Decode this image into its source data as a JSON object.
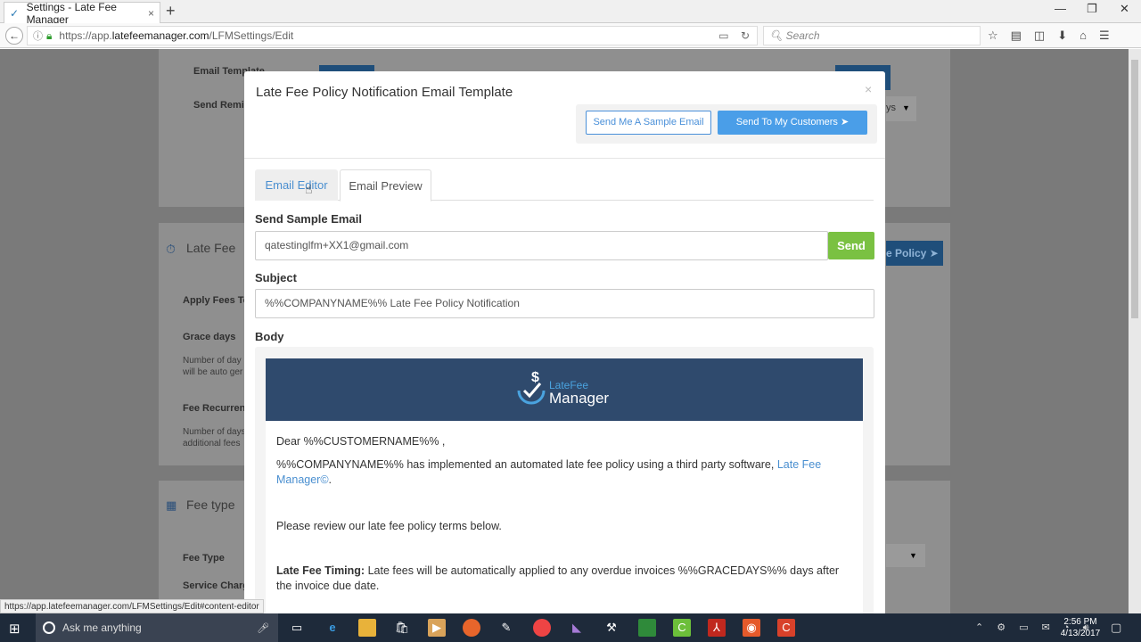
{
  "browser": {
    "tab_title": "Settings - Late Fee Manager",
    "tab_close": "×",
    "new_tab": "+",
    "url_prefix": "https://app.",
    "url_domain": "latefeemanager.com",
    "url_path": "/LFMSettings/Edit",
    "search_placeholder": "Search",
    "status_url": "https://app.latefeemanager.com/LFMSettings/Edit#content-editor"
  },
  "background": {
    "email_template_label": "Email Template",
    "send_reminder_label": "Send Remi",
    "late_fee_heading": "Late Fee",
    "apply_fees_label": "Apply Fees To",
    "grace_days_label": "Grace days",
    "grace_days_help": "Number of day",
    "grace_days_help2": "will be auto ger",
    "fee_recurrence_label": "Fee Recurren",
    "fee_recurrence_help": "Number of days",
    "fee_recurrence_help2": "additional fees",
    "fee_type_heading": "Fee type",
    "fee_type_label": "Fee Type",
    "service_charge_label": "Service Charg",
    "days_select": "ys",
    "policy_btn": "e Policy"
  },
  "modal": {
    "title": "Late Fee Policy Notification Email Template",
    "close": "×",
    "send_sample_btn": "Send Me A Sample Email",
    "send_customers_btn": "Send To My Customers",
    "tab_editor": "Email Editor",
    "tab_preview": "Email Preview",
    "send_sample_label": "Send Sample Email",
    "sample_email_value": "qatestinglfm+XX1@gmail.com",
    "send_btn": "Send",
    "subject_label": "Subject",
    "subject_value": "%%COMPANYNAME%% Late Fee Policy Notification",
    "body_label": "Body",
    "logo_line1": "LateFee",
    "logo_line2": "Manager",
    "greeting": "Dear %%CUSTOMERNAME%% ,",
    "para1_text": "%%COMPANYNAME%% has implemented an automated late fee policy using a third party software, ",
    "para1_link": "Late Fee Manager©",
    "para1_end": ".",
    "para2": "Please review our late fee policy terms below.",
    "timing_label": "Late Fee Timing:",
    "timing_text": " Late fees will be automatically applied to any overdue invoices %%GRACEDAYS%% days after the invoice due date."
  },
  "taskbar": {
    "cortana_text": "Ask me anything",
    "time": "2:56 PM",
    "date": "4/13/2017"
  },
  "colors": {
    "primary": "#4a9ee8",
    "success": "#7ac142",
    "banner": "#2f4a6d"
  }
}
